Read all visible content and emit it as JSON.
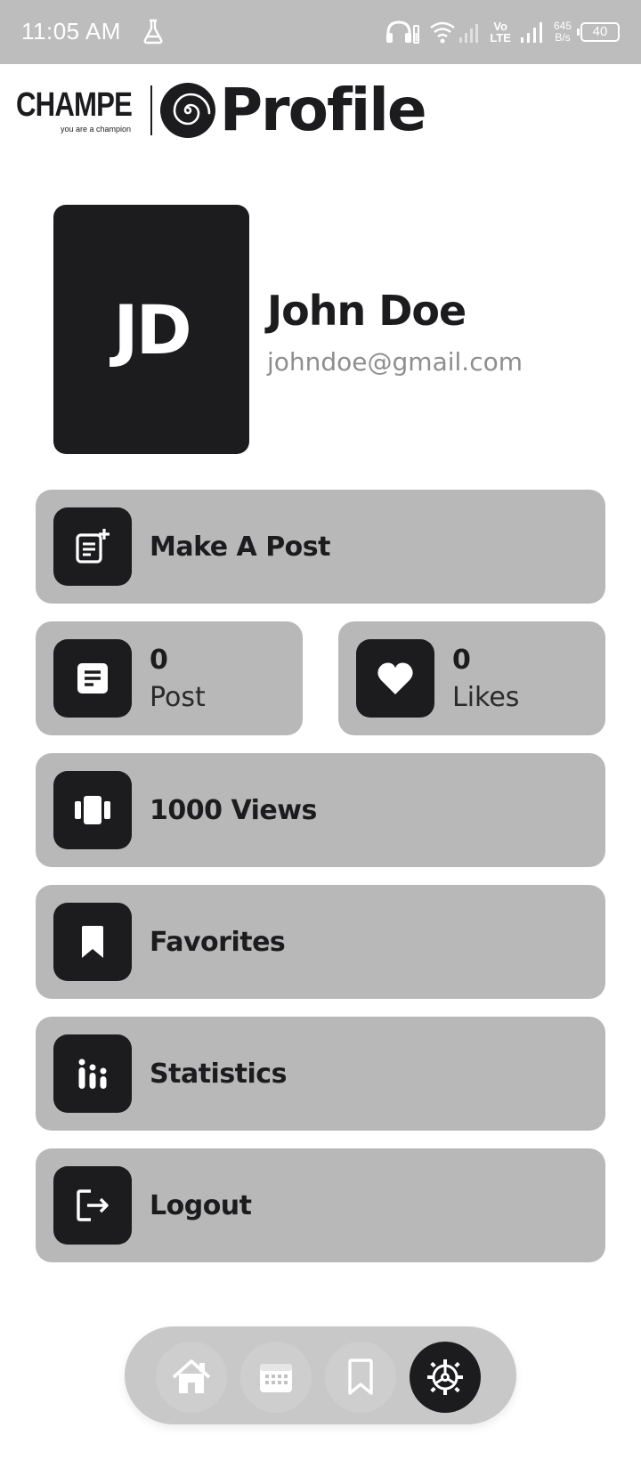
{
  "status_bar": {
    "time": "11:05 AM",
    "network_label_top": "Vo",
    "network_label_bottom": "LTE",
    "speed_value": "645",
    "speed_unit": "B/s",
    "battery": "40"
  },
  "header": {
    "brand_name": "CHAMPE",
    "brand_tagline": "you are a champion",
    "title": "Profile"
  },
  "profile": {
    "initials": "JD",
    "name": "John Doe",
    "email": "johndoe@gmail.com"
  },
  "menu": {
    "make_post": "Make A Post",
    "views": "1000 Views",
    "favorites": "Favorites",
    "statistics": "Statistics",
    "logout": "Logout"
  },
  "stats": {
    "posts": {
      "value": "0",
      "label": "Post"
    },
    "likes": {
      "value": "0",
      "label": "Likes"
    }
  },
  "bottom_nav": {
    "items": [
      "home-icon",
      "calendar-icon",
      "bookmark-icon",
      "settings-icon"
    ],
    "active": "settings-icon"
  },
  "colors": {
    "dark": "#1c1c1e",
    "card": "#b8b8b8",
    "status_bar": "#bdbdbd",
    "email": "#8e8e8e"
  }
}
